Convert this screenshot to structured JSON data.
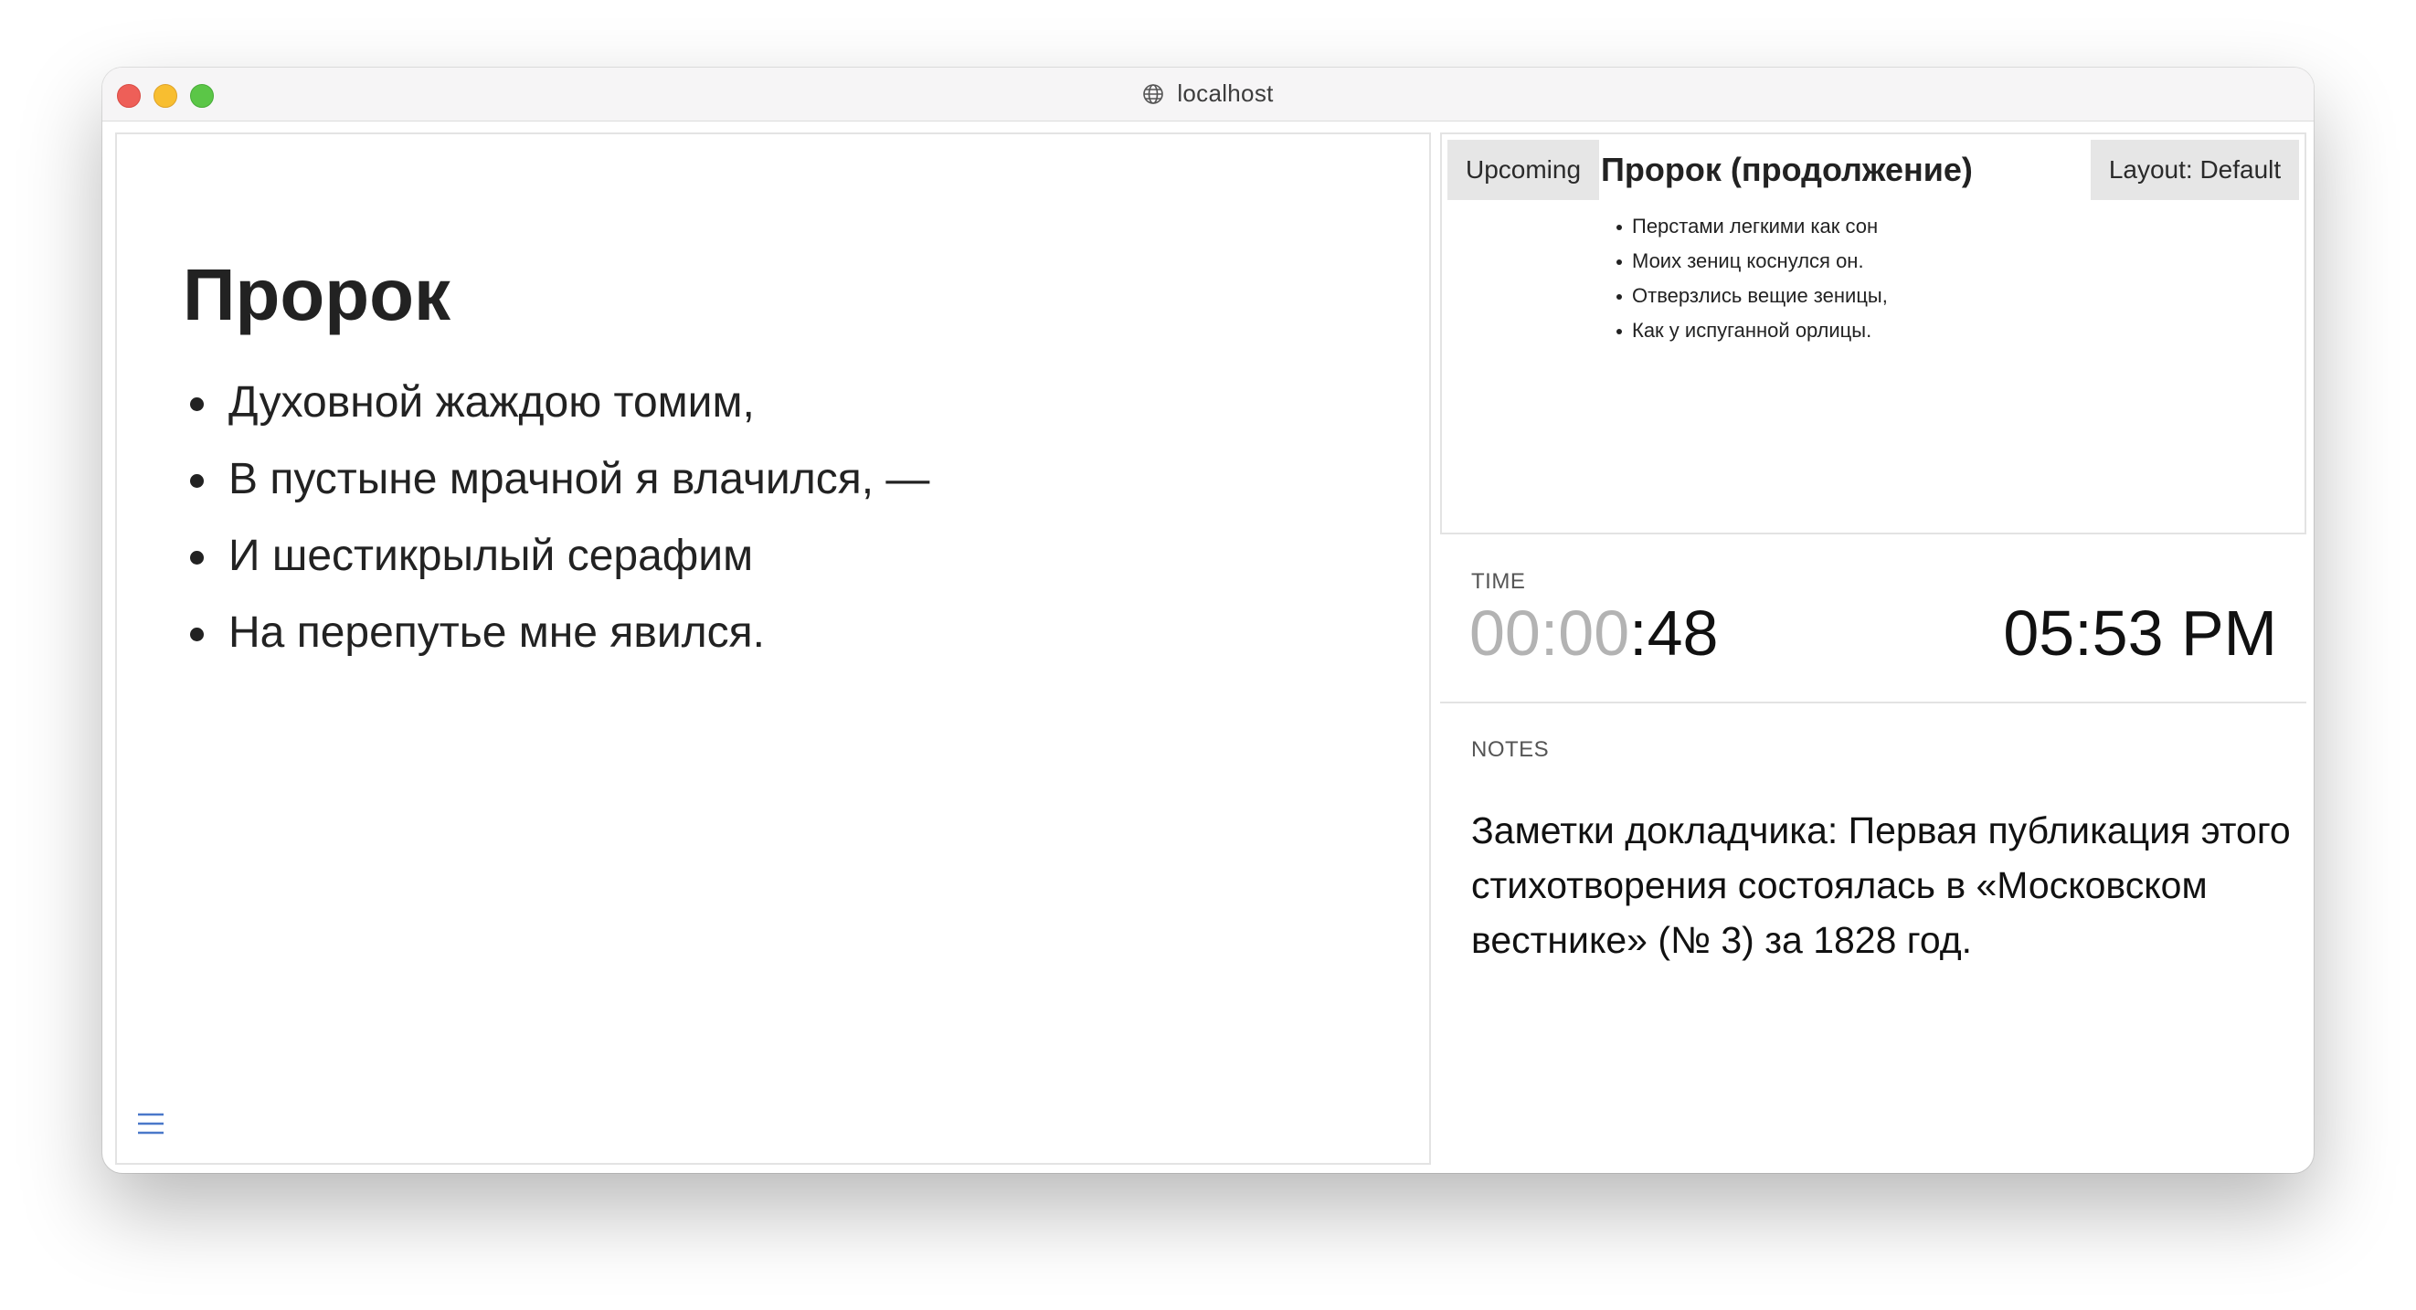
{
  "browser": {
    "url": "localhost"
  },
  "slide": {
    "title": "Пророк",
    "lines": [
      "Духовной жаждою томим,",
      "В пустыне мрачной я влачился, —",
      "И шестикрылый серафим",
      "На перепутье мне явился."
    ]
  },
  "upcoming": {
    "button_label": "Upcoming",
    "layout_label": "Layout: Default",
    "title": "Пророк (продолжение)",
    "lines": [
      "Перстами легкими как сон",
      "Моих зениц коснулся он.",
      "Отверзлись вещие зеницы,",
      "Как у испуганной орлицы."
    ]
  },
  "time": {
    "label": "TIME",
    "elapsed_dim": "00:00",
    "elapsed_active": ":48",
    "clock": "05:53 PM"
  },
  "notes": {
    "label": "NOTES",
    "text": "Заметки докладчика: Первая публикация этого стихотворения состоялась в «Московском вестнике» (№ 3) за 1828 год."
  },
  "icons": {
    "address_bar": "globe-icon",
    "menu": "hamburger-menu-icon"
  },
  "colors": {
    "menu_icon": "#4a78c9",
    "elapsed_dim": "#b3b3b3",
    "button_bg": "#e6e6e6"
  }
}
